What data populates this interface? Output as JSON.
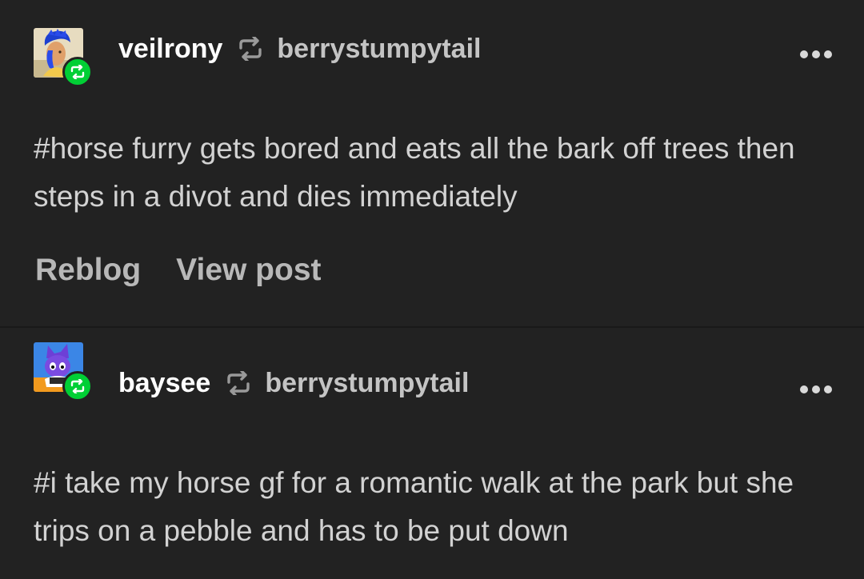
{
  "posts": [
    {
      "username": "veilrony",
      "reblogged_from": "berrystumpytail",
      "text": "#horse furry gets bored and eats all the bark off trees then steps in a divot and dies immediately",
      "actions": {
        "reblog": "Reblog",
        "view_post": "View post"
      }
    },
    {
      "username": "baysee",
      "reblogged_from": "berrystumpytail",
      "text": "#i take my horse gf for a romantic walk at the park but she trips on a pebble and has to be put down"
    }
  ],
  "icons": {
    "reblog": "reblog-icon",
    "more": "more-options-icon",
    "badge": "reblog-badge-icon"
  },
  "colors": {
    "background": "#222222",
    "badge_green": "#01cf35",
    "username": "#ffffff",
    "text": "#d2d2d2",
    "muted": "#b8b8b8"
  }
}
